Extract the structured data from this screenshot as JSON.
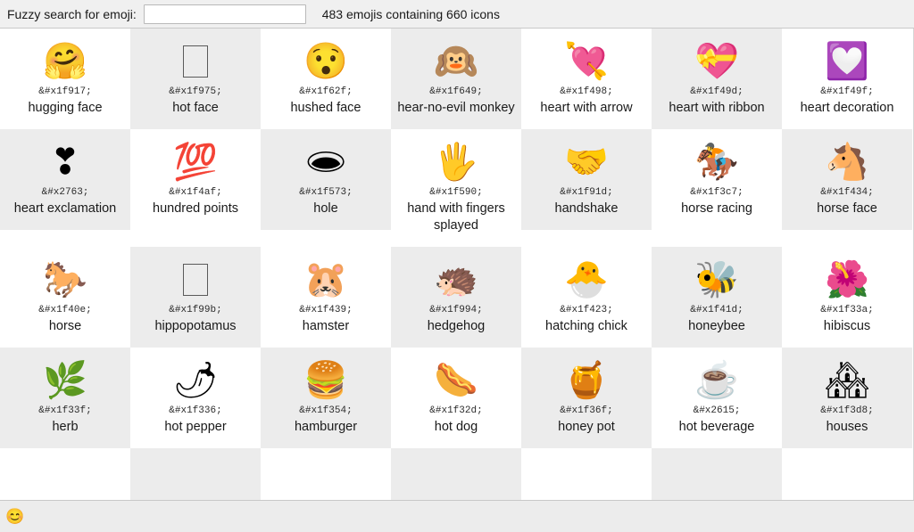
{
  "toolbar": {
    "search_label": "Fuzzy search for emoji:",
    "search_value": "",
    "search_placeholder": "",
    "count_text": "483 emojis containing 660 icons"
  },
  "statusbar": {
    "icon": "😊"
  },
  "grid": {
    "columns": 7,
    "shaded_color": "#ececec",
    "plain_color": "#ffffff",
    "cells": [
      {
        "glyph": "🤗",
        "entity": "&#x1f917;",
        "name": "hugging face",
        "shaded": false,
        "tofu": false
      },
      {
        "glyph": "",
        "entity": "&#x1f975;",
        "name": "hot face",
        "shaded": true,
        "tofu": true
      },
      {
        "glyph": "😯",
        "entity": "&#x1f62f;",
        "name": "hushed face",
        "shaded": false,
        "tofu": false
      },
      {
        "glyph": "🙉",
        "entity": "&#x1f649;",
        "name": "hear-no-evil monkey",
        "shaded": true,
        "tofu": false
      },
      {
        "glyph": "💘",
        "entity": "&#x1f498;",
        "name": "heart with arrow",
        "shaded": false,
        "tofu": false
      },
      {
        "glyph": "💝",
        "entity": "&#x1f49d;",
        "name": "heart with ribbon",
        "shaded": true,
        "tofu": false
      },
      {
        "glyph": "💟",
        "entity": "&#x1f49f;",
        "name": "heart decoration",
        "shaded": false,
        "tofu": false
      },
      {
        "glyph": "❣",
        "entity": "&#x2763;",
        "name": "heart exclamation",
        "shaded": true,
        "tofu": false
      },
      {
        "glyph": "💯",
        "entity": "&#x1f4af;",
        "name": "hundred points",
        "shaded": false,
        "tofu": false
      },
      {
        "glyph": "🕳",
        "entity": "&#x1f573;",
        "name": "hole",
        "shaded": true,
        "tofu": false
      },
      {
        "glyph": "🖐",
        "entity": "&#x1f590;",
        "name": "hand with fingers splayed",
        "shaded": false,
        "tofu": false
      },
      {
        "glyph": "🤝",
        "entity": "&#x1f91d;",
        "name": "handshake",
        "shaded": true,
        "tofu": false
      },
      {
        "glyph": "🏇",
        "entity": "&#x1f3c7;",
        "name": "horse racing",
        "shaded": false,
        "tofu": false
      },
      {
        "glyph": "🐴",
        "entity": "&#x1f434;",
        "name": "horse face",
        "shaded": true,
        "tofu": false
      },
      {
        "glyph": "🐎",
        "entity": "&#x1f40e;",
        "name": "horse",
        "shaded": false,
        "tofu": false
      },
      {
        "glyph": "",
        "entity": "&#x1f99b;",
        "name": "hippopotamus",
        "shaded": true,
        "tofu": true
      },
      {
        "glyph": "🐹",
        "entity": "&#x1f439;",
        "name": "hamster",
        "shaded": false,
        "tofu": false
      },
      {
        "glyph": "🦔",
        "entity": "&#x1f994;",
        "name": "hedgehog",
        "shaded": true,
        "tofu": false
      },
      {
        "glyph": "🐣",
        "entity": "&#x1f423;",
        "name": "hatching chick",
        "shaded": false,
        "tofu": false
      },
      {
        "glyph": "🐝",
        "entity": "&#x1f41d;",
        "name": "honeybee",
        "shaded": true,
        "tofu": false
      },
      {
        "glyph": "🌺",
        "entity": "&#x1f33a;",
        "name": "hibiscus",
        "shaded": false,
        "tofu": false
      },
      {
        "glyph": "🌿",
        "entity": "&#x1f33f;",
        "name": "herb",
        "shaded": true,
        "tofu": false
      },
      {
        "glyph": "🌶",
        "entity": "&#x1f336;",
        "name": "hot pepper",
        "shaded": false,
        "tofu": false
      },
      {
        "glyph": "🍔",
        "entity": "&#x1f354;",
        "name": "hamburger",
        "shaded": true,
        "tofu": false
      },
      {
        "glyph": "🌭",
        "entity": "&#x1f32d;",
        "name": "hot dog",
        "shaded": false,
        "tofu": false
      },
      {
        "glyph": "🍯",
        "entity": "&#x1f36f;",
        "name": "honey pot",
        "shaded": true,
        "tofu": false
      },
      {
        "glyph": "☕",
        "entity": "&#x2615;",
        "name": "hot beverage",
        "shaded": false,
        "tofu": false
      },
      {
        "glyph": "🏘",
        "entity": "&#x1f3d8;",
        "name": "houses",
        "shaded": true,
        "tofu": false
      },
      {
        "glyph": "",
        "entity": "",
        "name": "",
        "shaded": false,
        "tofu": false
      },
      {
        "glyph": "",
        "entity": "",
        "name": "",
        "shaded": true,
        "tofu": false
      },
      {
        "glyph": "",
        "entity": "",
        "name": "",
        "shaded": false,
        "tofu": false
      },
      {
        "glyph": "",
        "entity": "",
        "name": "",
        "shaded": true,
        "tofu": false
      },
      {
        "glyph": "",
        "entity": "",
        "name": "",
        "shaded": false,
        "tofu": false
      },
      {
        "glyph": "",
        "entity": "",
        "name": "",
        "shaded": true,
        "tofu": false
      },
      {
        "glyph": "",
        "entity": "",
        "name": "",
        "shaded": false,
        "tofu": false
      }
    ]
  }
}
